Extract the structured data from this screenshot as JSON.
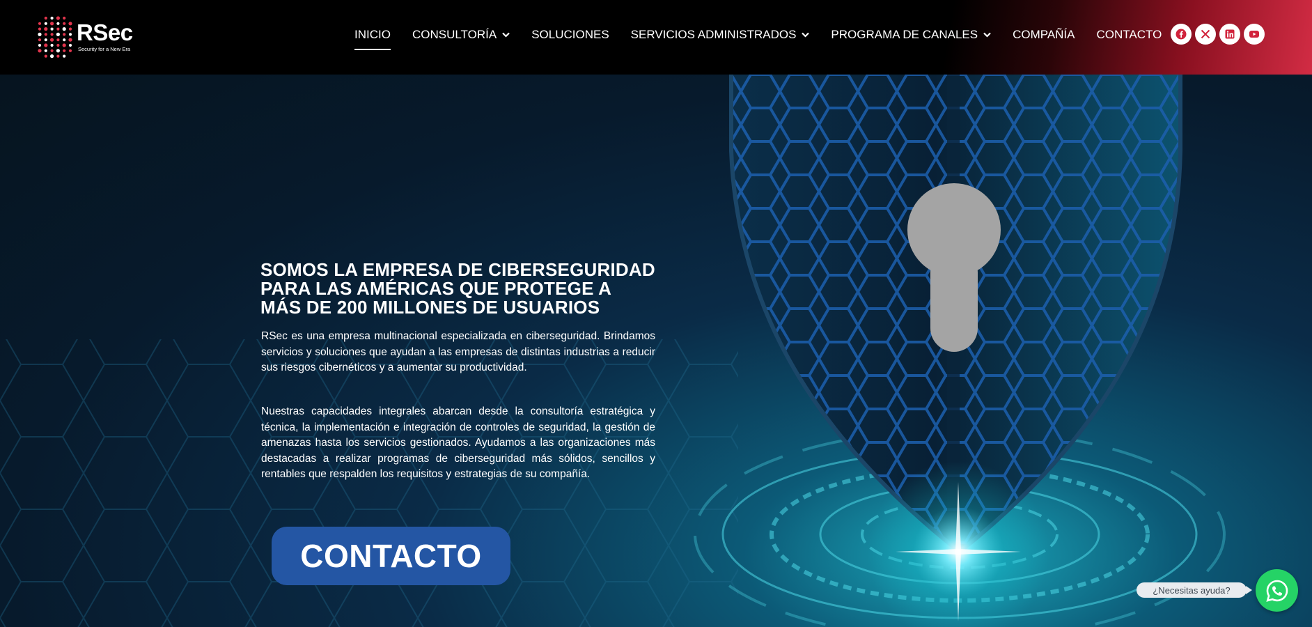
{
  "brand": {
    "name": "RSec",
    "tagline": "Security for a New Era",
    "accent": "#e2354d"
  },
  "nav": {
    "items": [
      {
        "label": "INICIO",
        "active": true,
        "dropdown": false
      },
      {
        "label": "CONSULTORÍA",
        "active": false,
        "dropdown": true
      },
      {
        "label": "SOLUCIONES",
        "active": false,
        "dropdown": false
      },
      {
        "label": "SERVICIOS ADMINISTRADOS",
        "active": false,
        "dropdown": true
      },
      {
        "label": "PROGRAMA DE CANALES",
        "active": false,
        "dropdown": true
      },
      {
        "label": "COMPAÑÍA",
        "active": false,
        "dropdown": false
      },
      {
        "label": "CONTACTO",
        "active": false,
        "dropdown": false
      }
    ]
  },
  "socials": [
    "facebook-icon",
    "x-icon",
    "linkedin-icon",
    "youtube-icon"
  ],
  "hero": {
    "headline_line1": "SOMOS LA EMPRESA DE CIBERSEGURIDAD",
    "headline_line2": "PARA LAS AMÉRICAS QUE PROTEGE A",
    "headline_line3": "MÁS DE 200 MILLONES DE USUARIOS",
    "paragraph1": "RSec es una empresa multinacional especializada en ciberseguridad. Brindamos servicios y soluciones que ayudan a las empresas de distintas industrias a reducir sus riesgos cibernéticos y a aumentar su productividad.",
    "paragraph2": "Nuestras capacidades integrales abarcan desde la consultoría estratégica y técnica, la implementación e integración de controles de seguridad, la gestión de amenazas hasta los servicios gestionados. Ayudamos a las organizaciones más destacadas a realizar programas de ciberseguridad más sólidos, sencillos y rentables que respalden los requisitos y estrategias de su compañía.",
    "cta_label": "CONTACTO",
    "cta_color": "#2456a4"
  },
  "whatsapp": {
    "tooltip": "¿Necesitas ayuda?",
    "color": "#25d366"
  }
}
